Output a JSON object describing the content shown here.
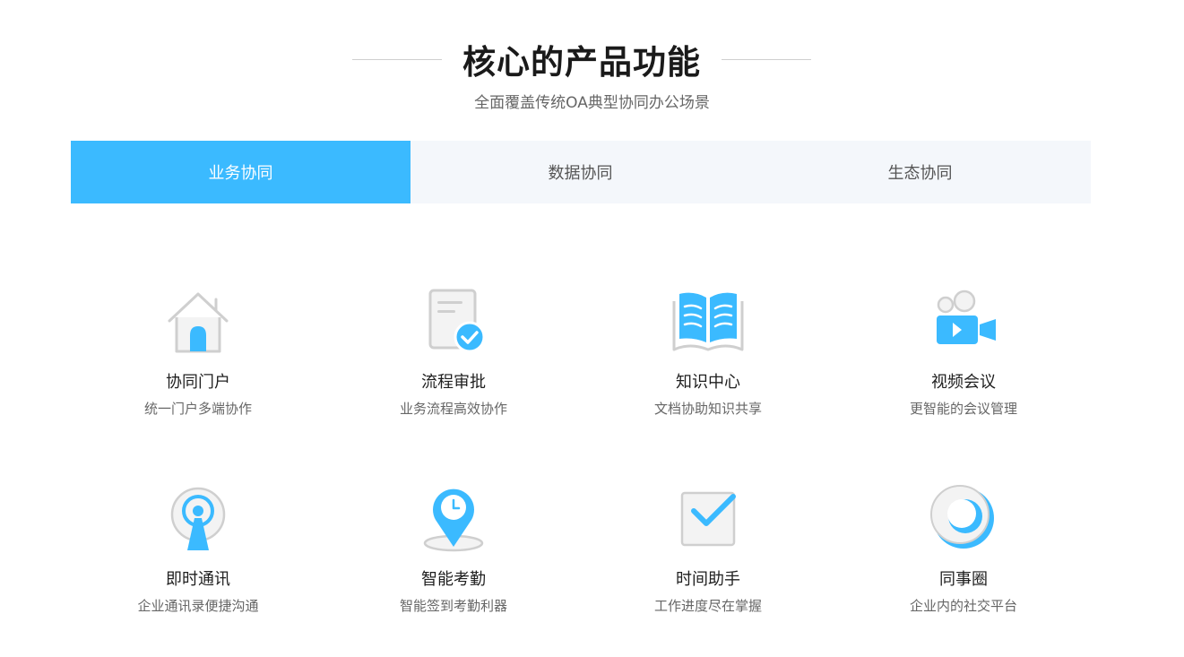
{
  "section": {
    "title": "核心的产品功能",
    "subtitle": "全面覆盖传统OA典型协同办公场景"
  },
  "tabs": [
    {
      "label": "业务协同",
      "active": true
    },
    {
      "label": "数据协同",
      "active": false
    },
    {
      "label": "生态协同",
      "active": false
    }
  ],
  "colors": {
    "accent": "#3bbaff",
    "tab_bg": "#f4f7fb",
    "icon_gray": "#d9d9d9"
  },
  "features": [
    {
      "icon": "house-icon",
      "title": "协同门户",
      "desc": "统一门户多端协作"
    },
    {
      "icon": "approval-document-icon",
      "title": "流程审批",
      "desc": "业务流程高效协作"
    },
    {
      "icon": "open-book-icon",
      "title": "知识中心",
      "desc": "文档协助知识共享"
    },
    {
      "icon": "video-camera-icon",
      "title": "视频会议",
      "desc": "更智能的会议管理"
    },
    {
      "icon": "broadcast-tower-icon",
      "title": "即时通讯",
      "desc": "企业通讯录便捷沟通"
    },
    {
      "icon": "location-clock-icon",
      "title": "智能考勤",
      "desc": "智能签到考勤利器"
    },
    {
      "icon": "checkbox-icon",
      "title": "时间助手",
      "desc": "工作进度尽在掌握"
    },
    {
      "icon": "circle-ring-icon",
      "title": "同事圈",
      "desc": "企业内的社交平台"
    }
  ]
}
